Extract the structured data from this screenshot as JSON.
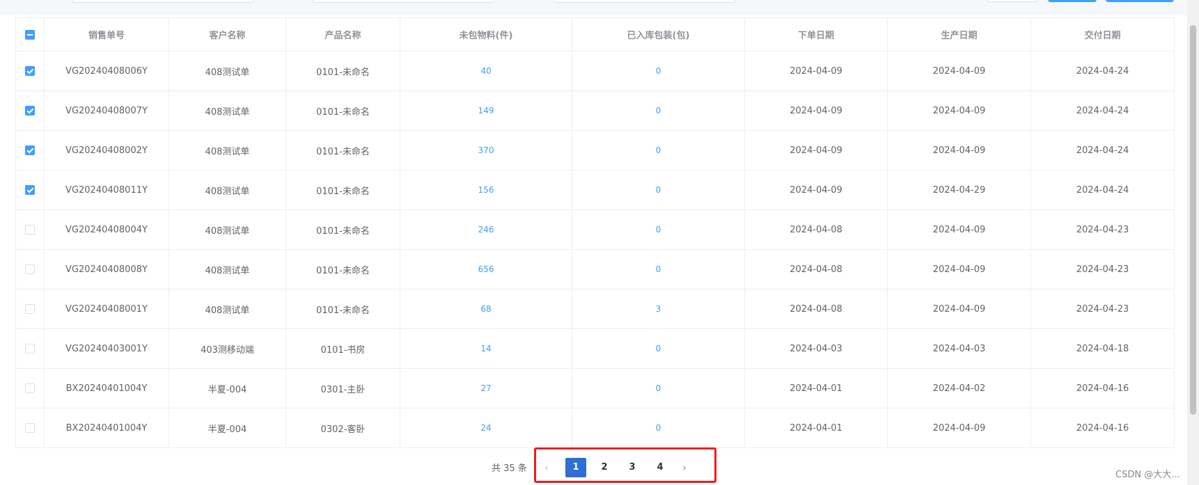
{
  "table": {
    "headers": [
      "销售单号",
      "客户名称",
      "产品名称",
      "未包物料(件)",
      "已入库包装(包)",
      "下单日期",
      "生产日期",
      "交付日期"
    ],
    "rows": [
      {
        "checked": true,
        "order": "VG20240408006Y",
        "customer": "408测试单",
        "product": "0101-未命名",
        "unpacked": "40",
        "packed": "0",
        "order_date": "2024-04-09",
        "prod_date": "2024-04-09",
        "delivery_date": "2024-04-24"
      },
      {
        "checked": true,
        "order": "VG20240408007Y",
        "customer": "408测试单",
        "product": "0101-未命名",
        "unpacked": "149",
        "packed": "0",
        "order_date": "2024-04-09",
        "prod_date": "2024-04-09",
        "delivery_date": "2024-04-24"
      },
      {
        "checked": true,
        "order": "VG20240408002Y",
        "customer": "408测试单",
        "product": "0101-未命名",
        "unpacked": "370",
        "packed": "0",
        "order_date": "2024-04-09",
        "prod_date": "2024-04-09",
        "delivery_date": "2024-04-24"
      },
      {
        "checked": true,
        "order": "VG20240408011Y",
        "customer": "408测试单",
        "product": "0101-未命名",
        "unpacked": "156",
        "packed": "0",
        "order_date": "2024-04-09",
        "prod_date": "2024-04-29",
        "delivery_date": "2024-04-24"
      },
      {
        "checked": false,
        "order": "VG20240408004Y",
        "customer": "408测试单",
        "product": "0101-未命名",
        "unpacked": "246",
        "packed": "0",
        "order_date": "2024-04-08",
        "prod_date": "2024-04-09",
        "delivery_date": "2024-04-23"
      },
      {
        "checked": false,
        "order": "VG20240408008Y",
        "customer": "408测试单",
        "product": "0101-未命名",
        "unpacked": "656",
        "packed": "0",
        "order_date": "2024-04-08",
        "prod_date": "2024-04-09",
        "delivery_date": "2024-04-23"
      },
      {
        "checked": false,
        "order": "VG20240408001Y",
        "customer": "408测试单",
        "product": "0101-未命名",
        "unpacked": "68",
        "packed": "3",
        "order_date": "2024-04-08",
        "prod_date": "2024-04-09",
        "delivery_date": "2024-04-23"
      },
      {
        "checked": false,
        "order": "VG20240403001Y",
        "customer": "403测移动端",
        "product": "0101-书房",
        "unpacked": "14",
        "packed": "0",
        "order_date": "2024-04-03",
        "prod_date": "2024-04-03",
        "delivery_date": "2024-04-18"
      },
      {
        "checked": false,
        "order": "BX20240401004Y",
        "customer": "半夏-004",
        "product": "0301-主卧",
        "unpacked": "27",
        "packed": "0",
        "order_date": "2024-04-01",
        "prod_date": "2024-04-02",
        "delivery_date": "2024-04-16"
      },
      {
        "checked": false,
        "order": "BX20240401004Y",
        "customer": "半夏-004",
        "product": "0302-客卧",
        "unpacked": "24",
        "packed": "0",
        "order_date": "2024-04-01",
        "prod_date": "2024-04-09",
        "delivery_date": "2024-04-16"
      }
    ]
  },
  "pagination": {
    "total_label": "共 35 条",
    "prev_icon": "chevron-left-icon",
    "next_icon": "chevron-right-icon",
    "pages": [
      "1",
      "2",
      "3",
      "4"
    ],
    "current_page": "1"
  },
  "colors": {
    "link": "#409eff",
    "active_page": "#2e6fd6",
    "highlight_border": "#ee1c1c"
  },
  "watermark": "CSDN @大大..."
}
